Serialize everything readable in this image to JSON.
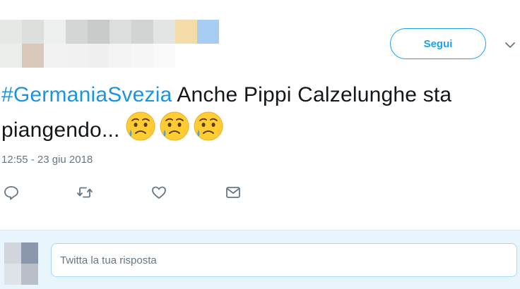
{
  "header": {
    "follow_label": "Segui",
    "follow_color": "#1da1f2"
  },
  "tweet": {
    "hashtag": "#GermaniaSvezia",
    "text": " Anche Pippi Calzelunghe sta piangendo...",
    "emojis": [
      "sad-but-relieved-face",
      "sad-but-relieved-face",
      "sad-but-relieved-face"
    ],
    "timestamp": "12:55 - 23 giu 2018",
    "hashtag_color": "#1b95e0"
  },
  "actions": {
    "icons": [
      "reply-icon",
      "retweet-icon",
      "like-icon",
      "direct-message-icon"
    ]
  },
  "reply": {
    "placeholder": "Twitta la tua risposta"
  }
}
